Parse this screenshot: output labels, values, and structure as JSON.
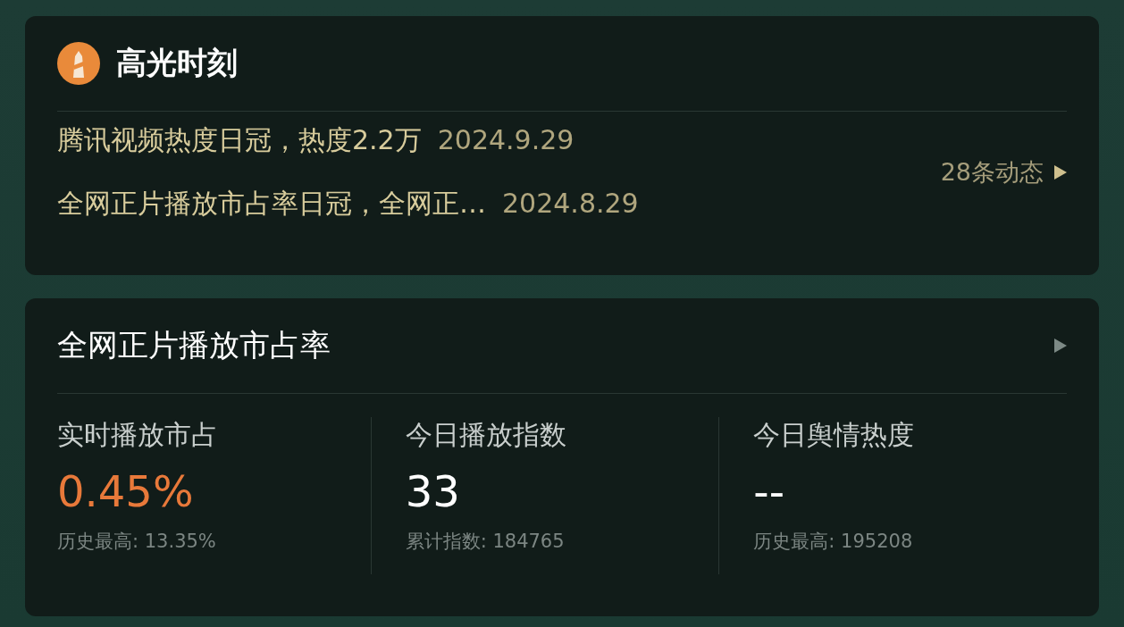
{
  "highlights": {
    "title": "高光时刻",
    "items": [
      {
        "text": "腾讯视频热度日冠，热度2.2万",
        "date": "2024.9.29"
      },
      {
        "text": "全网正片播放市占率日冠，全网正…",
        "date": "2024.8.29"
      }
    ],
    "more": "28条动态"
  },
  "market_share": {
    "title": "全网正片播放市占率",
    "metrics": [
      {
        "label": "实时播放市占",
        "value": "0.45%",
        "highlight": true,
        "note": "历史最高: 13.35%"
      },
      {
        "label": "今日播放指数",
        "value": "33",
        "highlight": false,
        "note": "累计指数: 184765"
      },
      {
        "label": "今日舆情热度",
        "value": "--",
        "highlight": false,
        "note": "历史最高: 195208"
      }
    ]
  }
}
